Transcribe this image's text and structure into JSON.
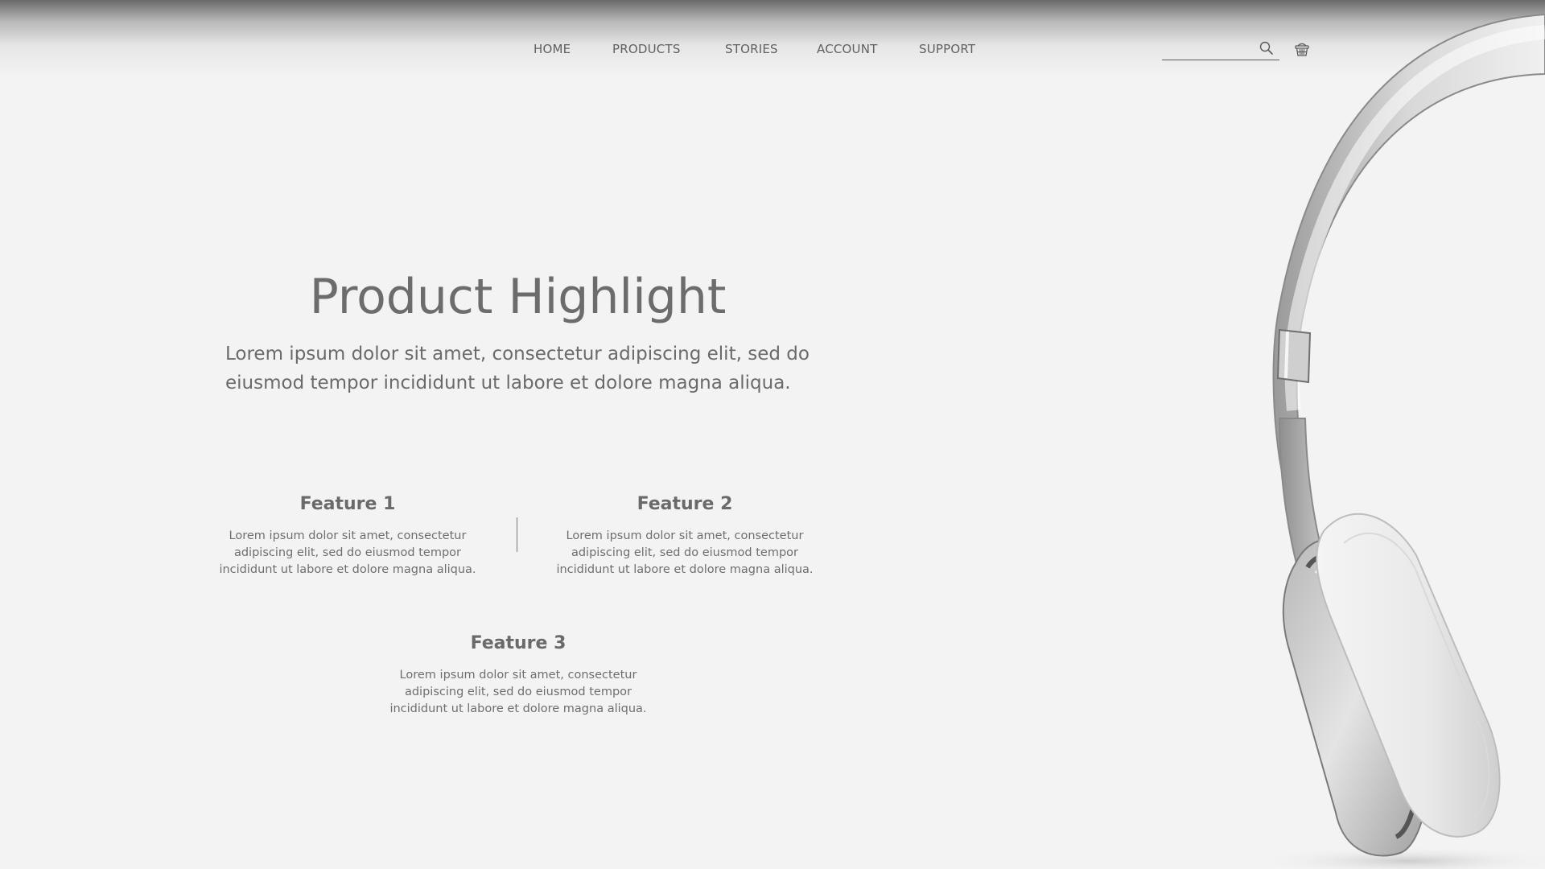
{
  "nav": {
    "items": [
      {
        "label": "HOME"
      },
      {
        "label": "PRODUCTS"
      },
      {
        "label": "STORIES"
      },
      {
        "label": "ACCOUNT"
      },
      {
        "label": "SUPPORT"
      }
    ]
  },
  "search": {
    "value": "",
    "placeholder": ""
  },
  "icons": {
    "search": "search-icon",
    "cart": "basket-icon"
  },
  "hero": {
    "title": "Product Highlight",
    "text": "Lorem ipsum dolor sit amet, consectetur adipiscing elit, sed do eiusmod tempor incididunt ut labore et dolore magna aliqua."
  },
  "features": [
    {
      "title": "Feature 1",
      "text": "Lorem ipsum dolor sit amet, consectetur adipiscing elit, sed do eiusmod tempor incididunt ut labore et dolore magna aliqua."
    },
    {
      "title": "Feature 2",
      "text": "Lorem ipsum dolor sit amet, consectetur adipiscing elit, sed do eiusmod tempor incididunt ut labore et dolore magna aliqua."
    },
    {
      "title": "Feature 3",
      "text": "Lorem ipsum dolor sit amet, consectetur adipiscing elit, sed do eiusmod tempor incididunt ut labore et dolore magna aliqua."
    }
  ],
  "colors": {
    "background": "#f3f3f3",
    "text": "#6e6e6e",
    "header_shade": "#6a6a6a"
  }
}
